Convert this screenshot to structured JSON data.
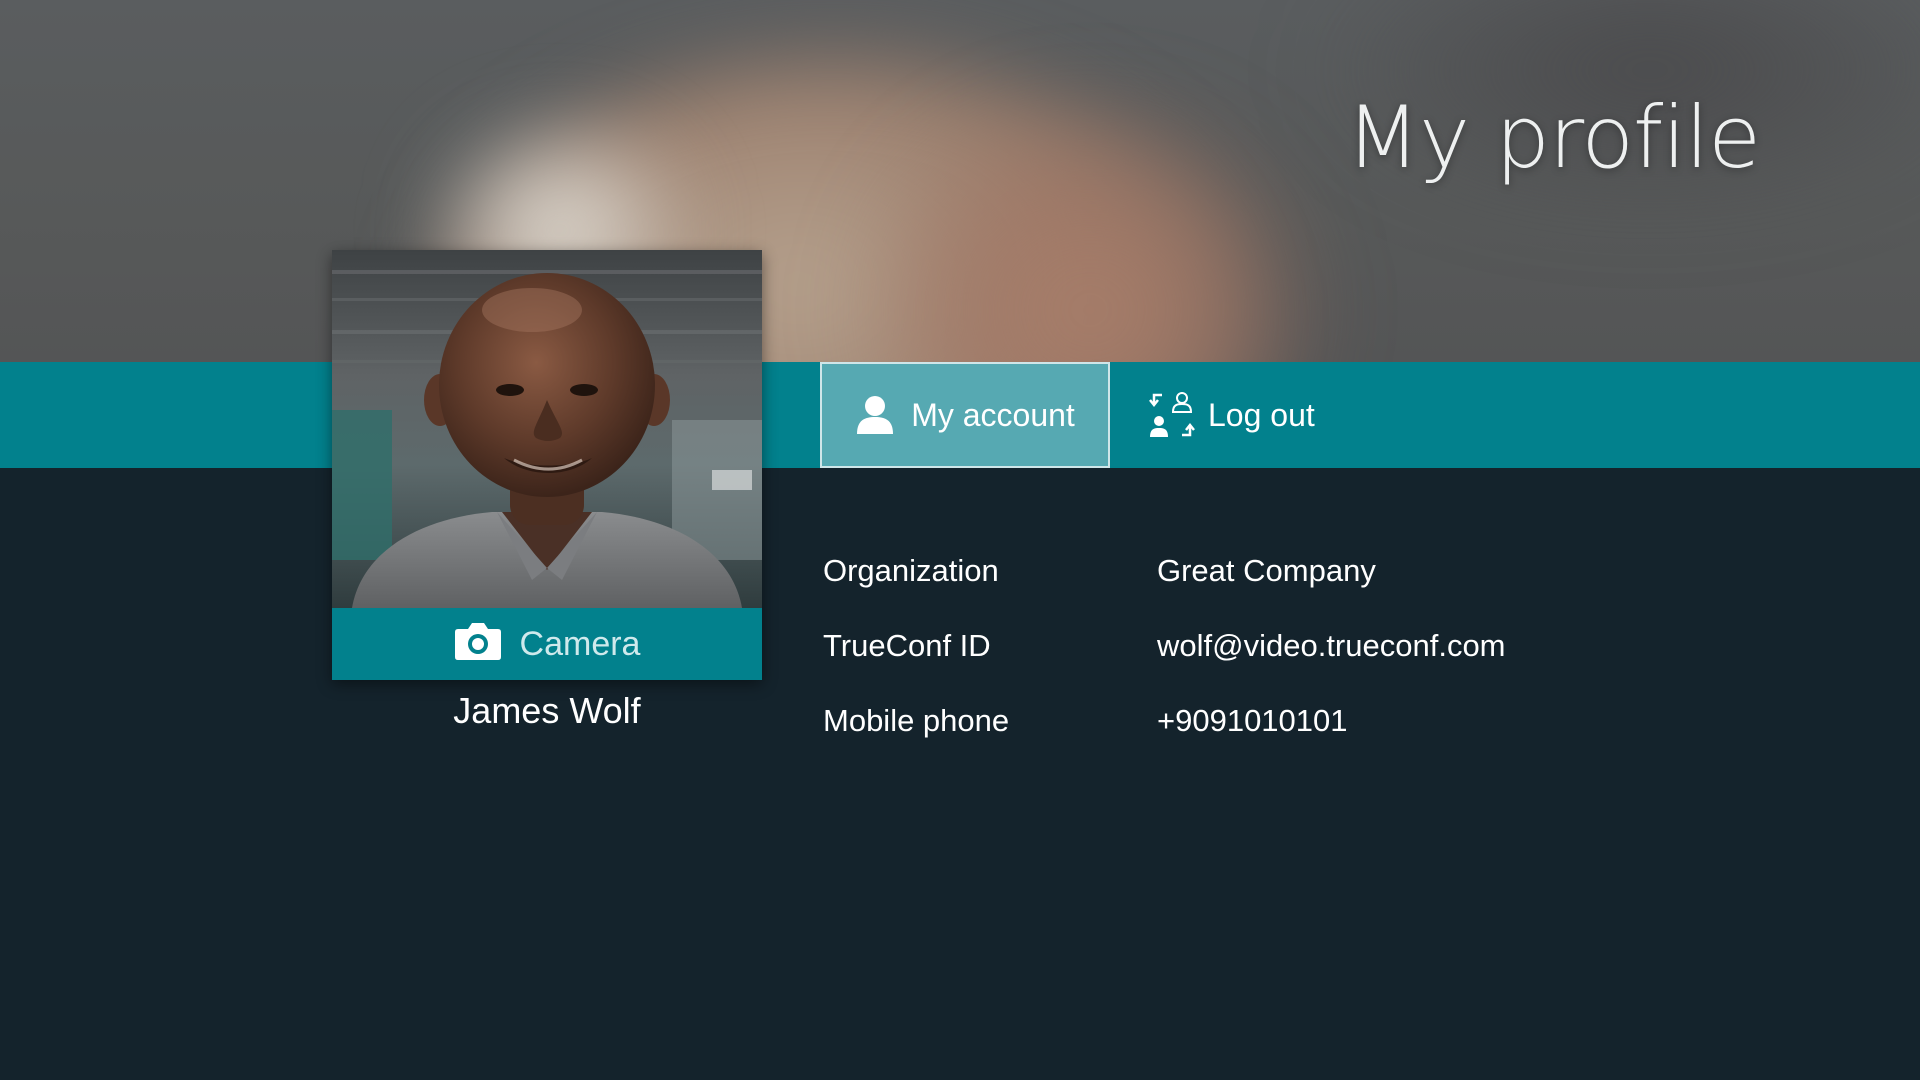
{
  "page": {
    "title": "My profile"
  },
  "tabs": [
    {
      "label": "My account",
      "icon": "user-icon",
      "active": true
    },
    {
      "label": "Log out",
      "icon": "switch-user-icon",
      "active": false
    }
  ],
  "profile": {
    "name": "James Wolf",
    "camera_label": "Camera",
    "camera_icon": "camera-icon"
  },
  "details": [
    {
      "label": "Organization",
      "value": "Great Company"
    },
    {
      "label": "TrueConf ID",
      "value": "wolf@video.trueconf.com"
    },
    {
      "label": "Mobile phone",
      "value": "+9091010101"
    }
  ],
  "colors": {
    "accent": "#02818d",
    "active_tab": "#56a9b2",
    "background": "#14232c"
  }
}
